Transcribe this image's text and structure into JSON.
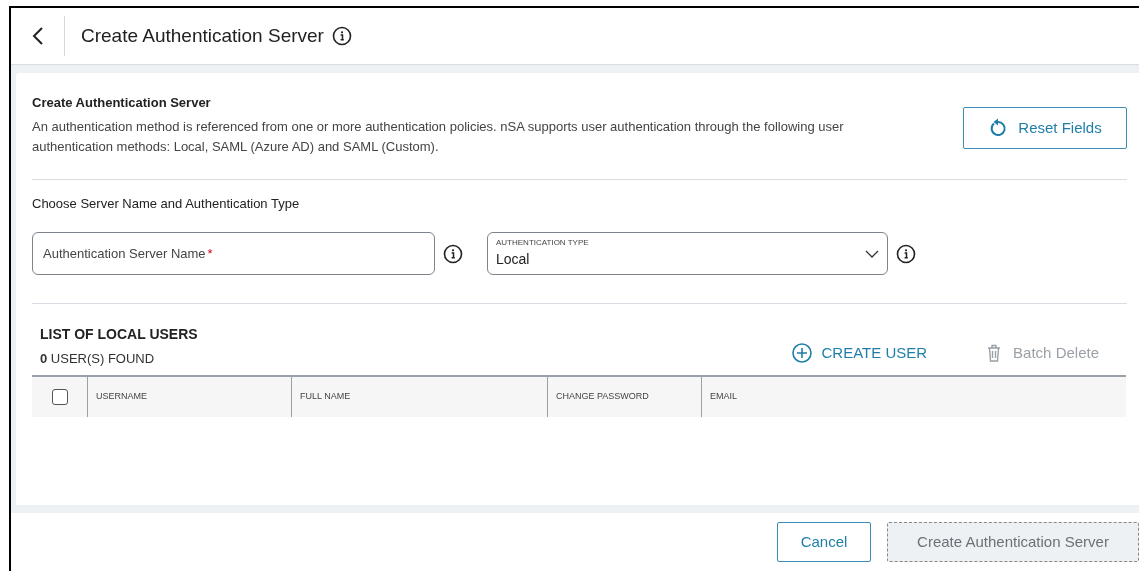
{
  "header": {
    "title": "Create Authentication Server"
  },
  "intro": {
    "title": "Create Authentication Server",
    "description": "An authentication method is referenced from one or more authentication policies. nSA supports user authentication through the following user authentication methods: Local, SAML (Azure AD) and SAML (Custom).",
    "reset_button": "Reset Fields"
  },
  "server_section": {
    "title": "Choose Server Name and Authentication Type",
    "name_field": {
      "placeholder": "Authentication Server Name",
      "required_mark": "*"
    },
    "type_field": {
      "label": "AUTHENTICATION TYPE",
      "value": "Local"
    }
  },
  "users": {
    "title": "LIST OF LOCAL USERS",
    "count": "**0** USER(S) FOUND",
    "create_button": "CREATE USER",
    "batch_delete": {
      "label": "Batch Delete",
      "disabled": true
    },
    "select_all": {
      "checked": false
    },
    "columns": [
      "USERNAME",
      "FULL NAME",
      "CHANGE PASSWORD",
      "EMAIL"
    ]
  },
  "footer": {
    "cancel": "Cancel",
    "submit": {
      "label": "Create Authentication Server",
      "disabled": true
    }
  }
}
